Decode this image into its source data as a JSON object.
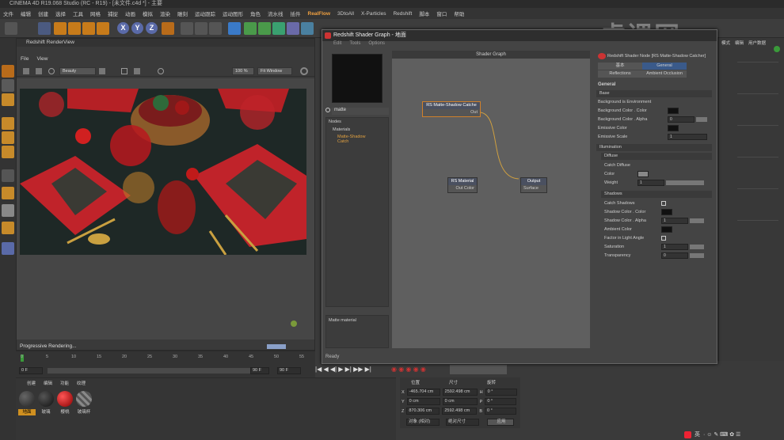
{
  "window_title": "CINEMA 4D R19.068 Studio (RC - R19) - [未文件.c4d *] - 主要",
  "menu": [
    "文件",
    "编辑",
    "创建",
    "选择",
    "工具",
    "网格",
    "捕捉",
    "动画",
    "模拟",
    "渲染",
    "雕刻",
    "运动跟踪",
    "运动图形",
    "角色",
    "流水线",
    "插件",
    "RealFlow",
    "3DtoAll",
    "X-Particles",
    "Redshift",
    "脚本",
    "窗口",
    "帮助"
  ],
  "render_view": {
    "title": "Redshift RenderView",
    "menu": [
      "File",
      "View"
    ],
    "aov": "Beauty",
    "zoom": "100 %",
    "fit": "Fit Window",
    "status": "Progressive Rendering..."
  },
  "timeline": {
    "ticks": [
      "0",
      "5",
      "10",
      "15",
      "20",
      "25",
      "30",
      "35",
      "40",
      "45",
      "50",
      "55"
    ],
    "start": "0 F",
    "end": "90 F",
    "current": "0 F",
    "max": "90 F"
  },
  "materials": {
    "tabs": [
      "创建",
      "编辑",
      "功能",
      "纹理"
    ],
    "items": [
      {
        "name": "地面"
      },
      {
        "name": "玻璃"
      },
      {
        "name": "樱桃"
      },
      {
        "name": "玻璃杯"
      }
    ]
  },
  "coords": {
    "headers": [
      "位置",
      "尺寸",
      "旋转"
    ],
    "rows": [
      {
        "axis": "X",
        "pos": "-465.704 cm",
        "size": "2592.498 cm",
        "rot": "H",
        "rotv": "0 °"
      },
      {
        "axis": "Y",
        "pos": "0 cm",
        "size": "0 cm",
        "rot": "P",
        "rotv": "0 °"
      },
      {
        "axis": "Z",
        "pos": "870.306 cm",
        "size": "2592.498 cm",
        "rot": "B",
        "rotv": "0 °"
      }
    ],
    "mode1": "对象 (相对)",
    "mode2": "绝对尺寸",
    "apply": "应用"
  },
  "shader": {
    "title": "Redshift Shader Graph - 地面",
    "menu": [
      "Edit",
      "Tools",
      "Options"
    ],
    "search": "matte",
    "nodes_header": "Nodes",
    "tree": [
      "Materials",
      "Matte-Shadow Catch"
    ],
    "desc": "Matte material",
    "status": "Ready",
    "graph_title": "Shader Graph",
    "node_matte": {
      "title": "RS Matte-Shadow Catche",
      "port": "Out"
    },
    "node_material": {
      "title": "RS Material",
      "port": "Out Color"
    },
    "node_output": {
      "title": "Output",
      "port": "Surface"
    },
    "props_title": "Redshift Shader Node [RS Matte-Shadow Catcher]",
    "tabs": [
      "基本",
      "General",
      "Reflections",
      "Ambient Occlusion"
    ],
    "general": "General",
    "base": "Base",
    "p_bg_env": "Background is Environment",
    "p_bg_color": "Background Color . Color",
    "p_bg_alpha": "Background Color . Alpha",
    "p_bg_alpha_v": "0",
    "p_emissive": "Emissive Color",
    "p_emissive_scale": "Emissive Scale",
    "p_emissive_scale_v": "1",
    "illum": "Illumination",
    "diffuse": "Diffuse",
    "p_catch_diffuse": "Catch Diffuse",
    "p_color": "Color",
    "p_weight": "Weight",
    "p_weight_v": "1",
    "shadows": "Shadows",
    "p_catch_shadows": "Catch Shadows",
    "p_sh_color": "Shadow Color . Color",
    "p_sh_alpha": "Shadow Color . Alpha",
    "p_sh_alpha_v": "1",
    "p_ambient": "Ambient Color",
    "p_factor": "Factor in Light Angle",
    "p_sat": "Saturation",
    "p_sat_v": "1",
    "p_trans": "Transparency",
    "p_trans_v": "0"
  },
  "attr_right": {
    "tabs": [
      "模式",
      "编辑",
      "用户数据"
    ]
  },
  "watermark": "虎课网",
  "tray": "英"
}
